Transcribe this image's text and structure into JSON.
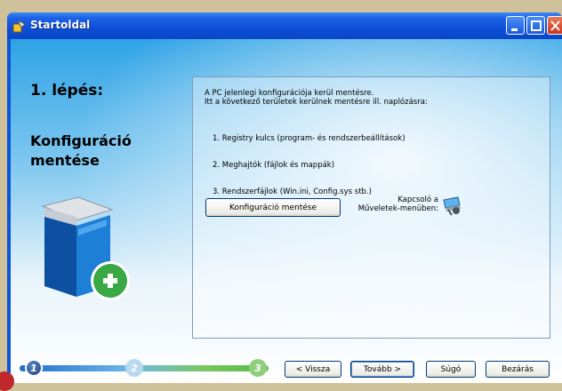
{
  "window": {
    "title": "Startoldal"
  },
  "step": {
    "heading": "1. lépés:",
    "subtitle_line1": "Konfiguráció",
    "subtitle_line2": "mentése"
  },
  "info": {
    "line1": "A PC jelenlegi konfigurációja kerül mentésre.",
    "line2": "Itt a következő területek kerülnek mentésre ill. naplózásra:",
    "items": [
      "1. Registry kulcs (program- és rendszerbeállítások)",
      "2. Meghajtók (fájlok és mappák)",
      "3. Rendszerfájlok (Win.ini, Config.sys stb.)"
    ]
  },
  "actions": {
    "save_button": "Konfiguráció mentése",
    "shortcut_line1": "Kapcsoló a",
    "shortcut_line2": "Műveletek-menüben:"
  },
  "progress": {
    "steps": [
      "1",
      "2",
      "3"
    ],
    "current_step": 1
  },
  "footer": {
    "back_label": "< Vissza",
    "next_label": "Tovább >",
    "help_label": "Súgó",
    "close_label": "Bezárás"
  },
  "colors": {
    "title_bar": "#0d4fd8",
    "client_top": "#2fa3e6",
    "book_blue": "#1565c0",
    "plus_green": "#3aa844"
  },
  "icons": {
    "app": "wizard-app-icon",
    "shortcut": "toolbar-shortcut-icon",
    "book": "backup-book-icon",
    "plus": "add-plus-icon"
  }
}
